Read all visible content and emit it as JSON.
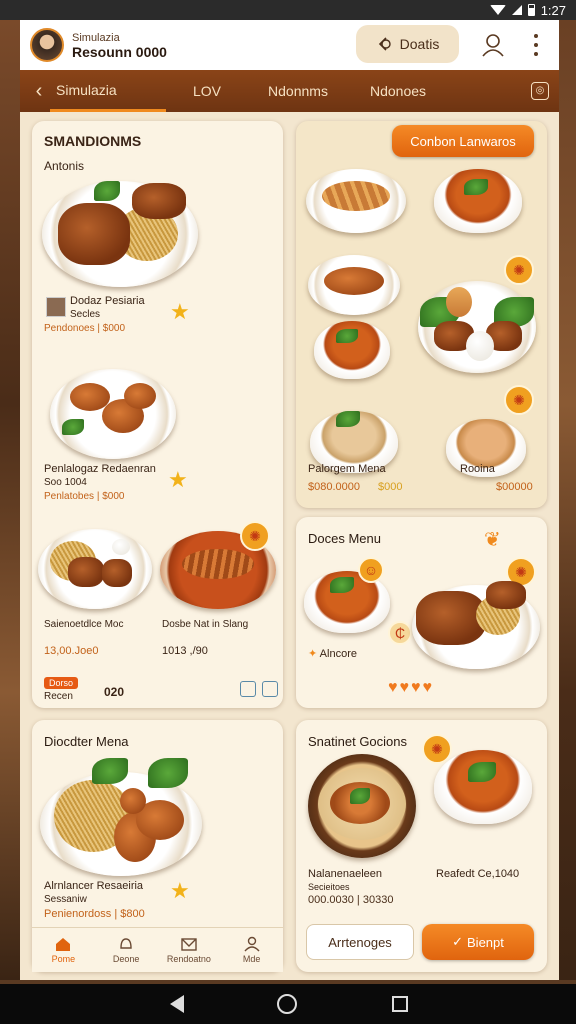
{
  "status_bar": {
    "time": "1:27"
  },
  "header": {
    "user_small": "Simulazia",
    "user_name": "Resounn 0000",
    "search_label": "Doatis",
    "search_icon": "search-icon",
    "profile_icon": "user-icon",
    "more_icon": "more-vertical-icon"
  },
  "tabs": {
    "back_icon": "chevron-left-icon",
    "items": [
      {
        "label": "Simulazia"
      },
      {
        "label": "LOV"
      },
      {
        "label": "Ndonnms"
      },
      {
        "label": "Ndonoes"
      }
    ],
    "action_icon": "settings-icon"
  },
  "card1": {
    "title": "SMANDIONMS",
    "subtitle": "Antonis",
    "item1_name": "Dodaz Pesiaria",
    "item1_sub": "Secles",
    "item1_price": "Pendonoes | $000",
    "item2_name": "Penlalogaz Redaenran",
    "item2_sub": "Soo 1004",
    "item2_price": "Penlatobes | $000",
    "item3_name": "Saienoetdlce Moc",
    "item3_price": "13,00.Joe0",
    "item4_name": "Dosbe Nat in Slang",
    "item4_price": "1013 ,/90",
    "tag": "Dorso",
    "footer_label": "Recen",
    "footer_value": "020"
  },
  "card2": {
    "button": "Conbon Lanwaros",
    "item1_name": "Palorgem Mena",
    "item1_price": "$080.0000",
    "item1_extra": "$000",
    "item2_name": "Rooina",
    "item2_price": "$00000"
  },
  "card3": {
    "title": "Doces Menu",
    "label": "Alncore"
  },
  "card4": {
    "title": "Diocdter Mena",
    "name": "Alrnlancer Resaeiria",
    "sub": "Sessaniw",
    "price": "Penienordoss | $800"
  },
  "card5": {
    "title": "Snatinet Gocions",
    "item1_name": "Nalanenaeleen",
    "item1_sub": "Secieitoes",
    "item1_price": "000.0030 | 30330",
    "item2_name": "Reafedt Ce,1040",
    "outline_button": "Arrtenoges",
    "primary_button": "Bienpt"
  },
  "bottom_nav": [
    {
      "label": "Pome",
      "icon": "home-icon"
    },
    {
      "label": "Deone",
      "icon": "bell-icon"
    },
    {
      "label": "Rendoatno",
      "icon": "mail-icon"
    },
    {
      "label": "Mde",
      "icon": "user-icon"
    }
  ]
}
